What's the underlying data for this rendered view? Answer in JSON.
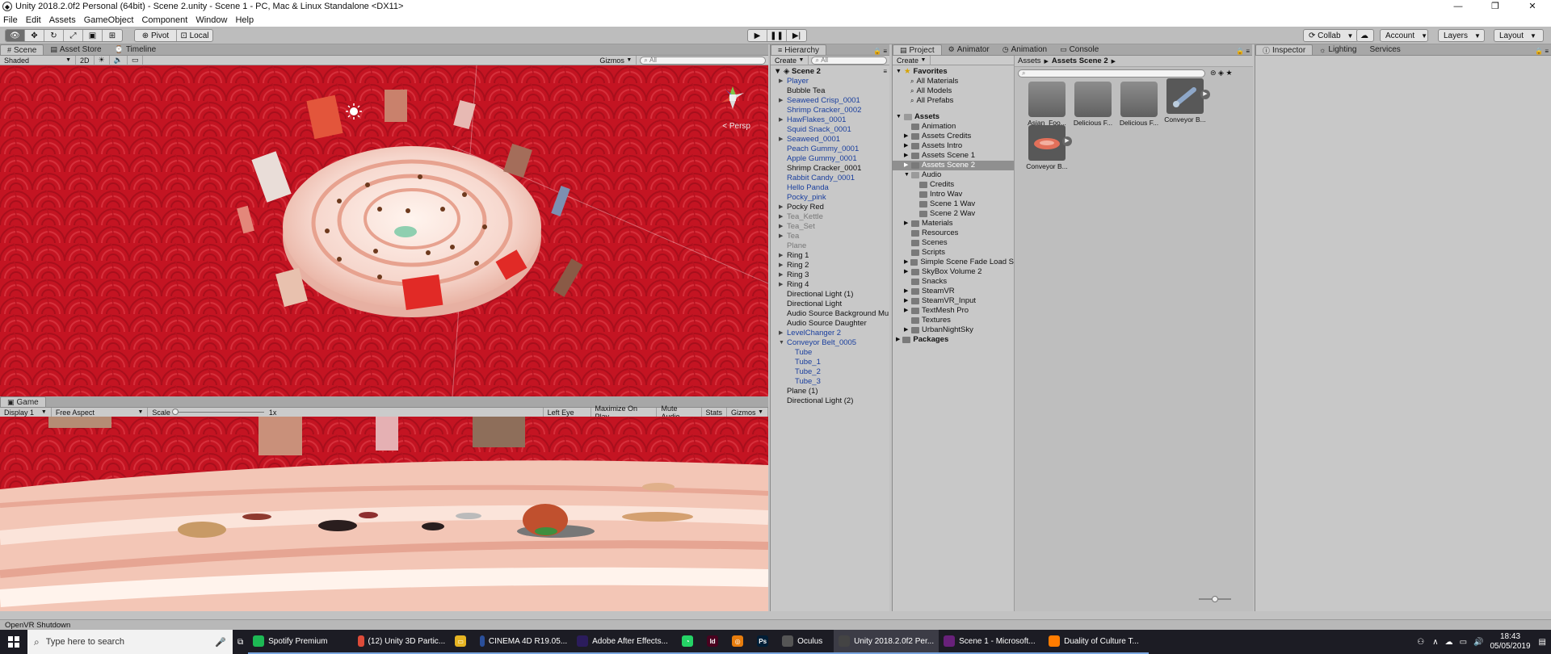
{
  "window": {
    "title": "Unity 2018.2.0f2 Personal (64bit) - Scene 2.unity - Scene 1 - PC, Mac & Linux Standalone <DX11>"
  },
  "menu": [
    "File",
    "Edit",
    "Assets",
    "GameObject",
    "Component",
    "Window",
    "Help"
  ],
  "toolbar": {
    "pivot": "Pivot",
    "local": "Local",
    "collab": "Collab",
    "account": "Account",
    "layers": "Layers",
    "layout": "Layout"
  },
  "scene_panel": {
    "tabs": [
      "Scene",
      "Asset Store",
      "Timeline"
    ],
    "shading": "Shaded",
    "mode_2d": "2D",
    "gizmos": "Gizmos",
    "search_placeholder": "All",
    "persp_label": "< Persp"
  },
  "game_panel": {
    "tab": "Game",
    "display": "Display 1",
    "aspect": "Free Aspect",
    "scale_label": "Scale",
    "scale_value": "1x",
    "eye": "Left Eye",
    "maximize": "Maximize On Play",
    "mute": "Mute Audio",
    "stats": "Stats",
    "gizmos": "Gizmos"
  },
  "hierarchy": {
    "tab": "Hierarchy",
    "create": "Create",
    "search_placeholder": "All",
    "scene_name": "Scene 2",
    "items": [
      {
        "label": "Player",
        "color": "blue",
        "arrow": true
      },
      {
        "label": "Bubble Tea",
        "color": "black",
        "arrow": false
      },
      {
        "label": "Seaweed Crisp_0001",
        "color": "blue",
        "arrow": true
      },
      {
        "label": "Shrimp Cracker_0002",
        "color": "blue",
        "arrow": false
      },
      {
        "label": "HawFlakes_0001",
        "color": "blue",
        "arrow": true
      },
      {
        "label": "Squid Snack_0001",
        "color": "blue",
        "arrow": false
      },
      {
        "label": "Seaweed_0001",
        "color": "blue",
        "arrow": true
      },
      {
        "label": "Peach Gummy_0001",
        "color": "blue",
        "arrow": false
      },
      {
        "label": "Apple Gummy_0001",
        "color": "blue",
        "arrow": false
      },
      {
        "label": "Shrimp Cracker_0001",
        "color": "black",
        "arrow": false
      },
      {
        "label": "Rabbit Candy_0001",
        "color": "blue",
        "arrow": false
      },
      {
        "label": "Hello Panda",
        "color": "blue",
        "arrow": false
      },
      {
        "label": "Pocky_pink",
        "color": "blue",
        "arrow": false
      },
      {
        "label": "Pocky Red",
        "color": "black",
        "arrow": true
      },
      {
        "label": "Tea_Kettle",
        "color": "gray",
        "arrow": true
      },
      {
        "label": "Tea_Set",
        "color": "gray",
        "arrow": true
      },
      {
        "label": "Tea",
        "color": "gray",
        "arrow": true
      },
      {
        "label": "Plane",
        "color": "gray",
        "arrow": false
      },
      {
        "label": "Ring 1",
        "color": "black",
        "arrow": true
      },
      {
        "label": "Ring 2",
        "color": "black",
        "arrow": true
      },
      {
        "label": "Ring 3",
        "color": "black",
        "arrow": true
      },
      {
        "label": "Ring 4",
        "color": "black",
        "arrow": true
      },
      {
        "label": "Directional Light (1)",
        "color": "black",
        "arrow": false
      },
      {
        "label": "Directional Light",
        "color": "black",
        "arrow": false
      },
      {
        "label": "Audio Source Background Mu",
        "color": "black",
        "arrow": false
      },
      {
        "label": "Audio Source Daughter",
        "color": "black",
        "arrow": false
      },
      {
        "label": "LevelChanger 2",
        "color": "blue",
        "arrow": true
      },
      {
        "label": "Conveyor Belt_0005",
        "color": "blue",
        "arrow": true,
        "open": true
      },
      {
        "label": "Tube",
        "color": "blue",
        "arrow": false,
        "indent": 1
      },
      {
        "label": "Tube_1",
        "color": "blue",
        "arrow": false,
        "indent": 1
      },
      {
        "label": "Tube_2",
        "color": "blue",
        "arrow": false,
        "indent": 1
      },
      {
        "label": "Tube_3",
        "color": "blue",
        "arrow": false,
        "indent": 1
      },
      {
        "label": "Plane (1)",
        "color": "black",
        "arrow": false
      },
      {
        "label": "Directional Light (2)",
        "color": "black",
        "arrow": false
      }
    ]
  },
  "project": {
    "tabs": [
      "Project",
      "Animator",
      "Animation",
      "Console"
    ],
    "create": "Create",
    "favorites_title": "Favorites",
    "favorites": [
      "All Materials",
      "All Models",
      "All Prefabs"
    ],
    "assets_title": "Assets",
    "tree": [
      {
        "label": "Animation",
        "arrow": false,
        "indent": 1
      },
      {
        "label": "Assets Credits",
        "arrow": true,
        "indent": 1
      },
      {
        "label": "Assets Intro",
        "arrow": true,
        "indent": 1
      },
      {
        "label": "Assets Scene 1",
        "arrow": true,
        "indent": 1
      },
      {
        "label": "Assets Scene 2",
        "arrow": true,
        "indent": 1,
        "selected": true
      },
      {
        "label": "Audio",
        "arrow": true,
        "indent": 1,
        "open": true
      },
      {
        "label": "Credits",
        "arrow": false,
        "indent": 2
      },
      {
        "label": "Intro Wav",
        "arrow": false,
        "indent": 2
      },
      {
        "label": "Scene 1 Wav",
        "arrow": false,
        "indent": 2
      },
      {
        "label": "Scene 2 Wav",
        "arrow": false,
        "indent": 2
      },
      {
        "label": "Materials",
        "arrow": true,
        "indent": 1
      },
      {
        "label": "Resources",
        "arrow": false,
        "indent": 1
      },
      {
        "label": "Scenes",
        "arrow": false,
        "indent": 1
      },
      {
        "label": "Scripts",
        "arrow": false,
        "indent": 1
      },
      {
        "label": "Simple Scene Fade Load S",
        "arrow": true,
        "indent": 1
      },
      {
        "label": "SkyBox Volume 2",
        "arrow": true,
        "indent": 1
      },
      {
        "label": "Snacks",
        "arrow": false,
        "indent": 1
      },
      {
        "label": "SteamVR",
        "arrow": true,
        "indent": 1
      },
      {
        "label": "SteamVR_Input",
        "arrow": true,
        "indent": 1
      },
      {
        "label": "TextMesh Pro",
        "arrow": true,
        "indent": 1
      },
      {
        "label": "Textures",
        "arrow": false,
        "indent": 1
      },
      {
        "label": "UrbanNightSky",
        "arrow": true,
        "indent": 1
      }
    ],
    "packages_title": "Packages",
    "breadcrumb": [
      "Assets",
      "Assets Scene 2"
    ],
    "grid": [
      {
        "label": "Asian_Foo...",
        "kind": "folder"
      },
      {
        "label": "Delicious F...",
        "kind": "folder"
      },
      {
        "label": "Delicious F...",
        "kind": "folder"
      },
      {
        "label": "Conveyor B...",
        "kind": "prefab-tube"
      },
      {
        "label": "Conveyor B...",
        "kind": "prefab-disc"
      }
    ]
  },
  "inspector": {
    "tabs": [
      "Inspector",
      "Lighting",
      "Services"
    ]
  },
  "status": {
    "message": "OpenVR Shutdown"
  },
  "taskbar": {
    "search_placeholder": "Type here to search",
    "items": [
      {
        "label": "Spotify Premium",
        "icon_color": "#1db954"
      },
      {
        "label": "(12) Unity 3D Partic...",
        "icon_color": "#dd4b39"
      },
      {
        "label": "CINEMA 4D R19.05...",
        "icon_color": "#2a4f9a"
      },
      {
        "label": "Adobe After Effects...",
        "icon_color": "#2b1c5c"
      },
      {
        "label": "Oculus",
        "icon_color": "#555555"
      },
      {
        "label": "Unity 2018.2.0f2 Per...",
        "icon_color": "#444444"
      },
      {
        "label": "Scene 1 - Microsoft...",
        "icon_color": "#68217a"
      },
      {
        "label": "Duality of Culture T...",
        "icon_color": "#ff7c00"
      }
    ],
    "time": "18:43",
    "date": "05/05/2019"
  },
  "colors": {
    "scene_red": "#c41422",
    "game_floor": "#f3c6b6",
    "selection_blue": "#1a3f9e"
  }
}
